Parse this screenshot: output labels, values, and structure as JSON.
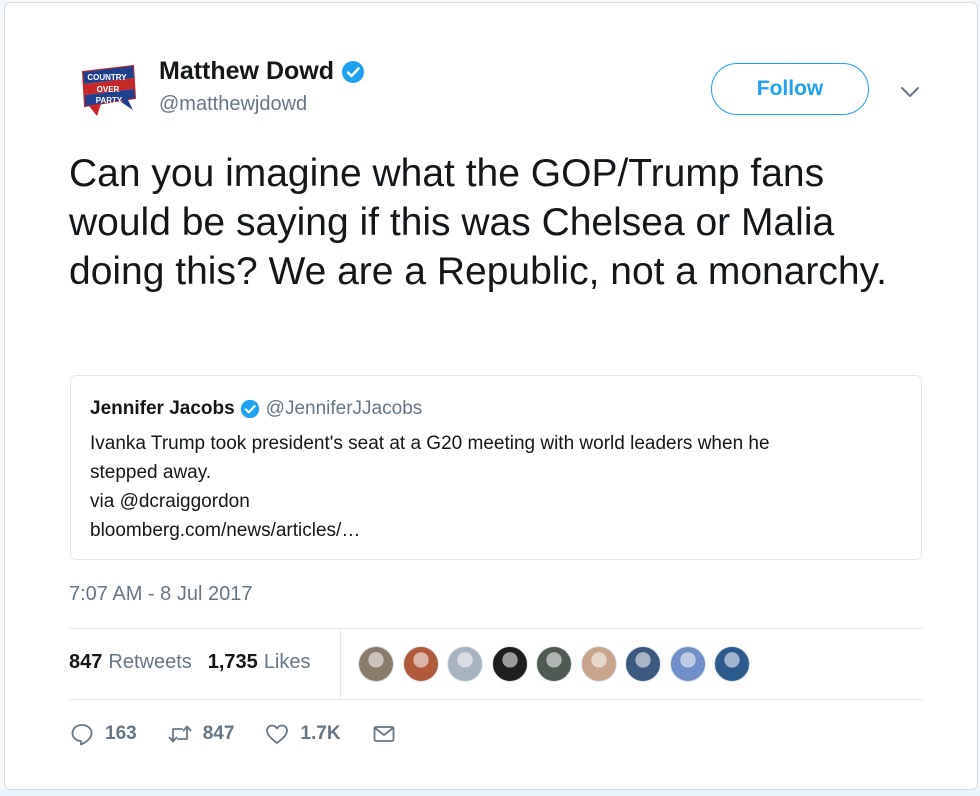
{
  "author": {
    "name": "Matthew Dowd",
    "handle": "@matthewjdowd",
    "avatar_icon": "country-over-party-logo-icon",
    "verified_icon": "verified-badge-icon"
  },
  "follow_button": {
    "label": "Follow"
  },
  "tweet": {
    "text": "Can you imagine what the GOP/Trump fans would be saying if this was Chelsea or Malia doing this? We are a Republic, not a monarchy."
  },
  "quoted_tweet": {
    "name": "Jennifer Jacobs",
    "handle": "@JenniferJJacobs",
    "lines": [
      "Ivanka Trump took president's seat at a G20 meeting with world leaders when he",
      "stepped away.",
      "via @dcraiggordon",
      "bloomberg.com/news/articles/…"
    ]
  },
  "timestamp": "7:07 AM - 8 Jul 2017",
  "stats": {
    "retweets_count": "847",
    "retweets_label": "Retweets",
    "likes_count": "1,735",
    "likes_label": "Likes"
  },
  "likers": [
    {
      "name": "liker-avatar-1",
      "color": "#8a7b6a"
    },
    {
      "name": "liker-avatar-2",
      "color": "#b05a3a"
    },
    {
      "name": "liker-avatar-3",
      "color": "#a7b4bf"
    },
    {
      "name": "liker-avatar-4",
      "color": "#1e1e1e"
    },
    {
      "name": "liker-avatar-5",
      "color": "#4f5a52"
    },
    {
      "name": "liker-avatar-6",
      "color": "#c9a38a"
    },
    {
      "name": "liker-avatar-7",
      "color": "#3b5a82"
    },
    {
      "name": "liker-avatar-8",
      "color": "#6e8fc7"
    },
    {
      "name": "liker-avatar-9",
      "color": "#2a5b8c"
    }
  ],
  "actions": {
    "reply_count": "163",
    "retweet_count": "847",
    "like_count": "1.7K"
  },
  "colors": {
    "accent": "#1da1f2",
    "text": "#14171a",
    "secondary": "#657786",
    "border": "#e1e8ed"
  }
}
